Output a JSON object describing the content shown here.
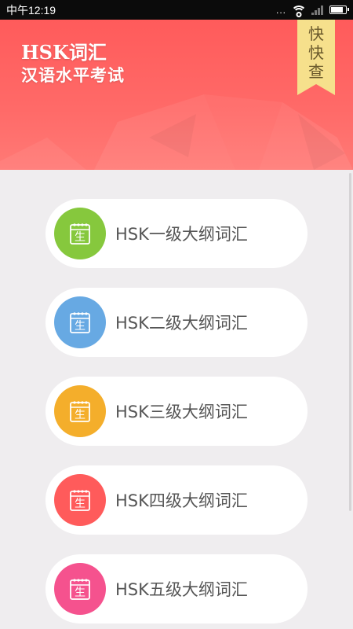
{
  "status_bar": {
    "time": "中午12:19",
    "more": "..."
  },
  "header": {
    "title_line1": "HSK词汇",
    "title_line2": "汉语水平考试",
    "ribbon_chars": [
      "快",
      "快",
      "查"
    ],
    "colors": {
      "background": "#ff5b5b",
      "ribbon": "#f6e08c",
      "ribbon_text": "#6b5a2c"
    }
  },
  "calendar_icon_char": "生",
  "levels": [
    {
      "label": "HSK一级大纲词汇",
      "color": "#86c83d",
      "icon": "calendar-icon"
    },
    {
      "label": "HSK二级大纲词汇",
      "color": "#67a9e3",
      "icon": "calendar-icon"
    },
    {
      "label": "HSK三级大纲词汇",
      "color": "#f4ae2b",
      "icon": "calendar-icon"
    },
    {
      "label": "HSK四级大纲词汇",
      "color": "#ff5b5b",
      "icon": "calendar-icon"
    },
    {
      "label": "HSK五级大纲词汇",
      "color": "#f5528e",
      "icon": "calendar-icon"
    }
  ]
}
